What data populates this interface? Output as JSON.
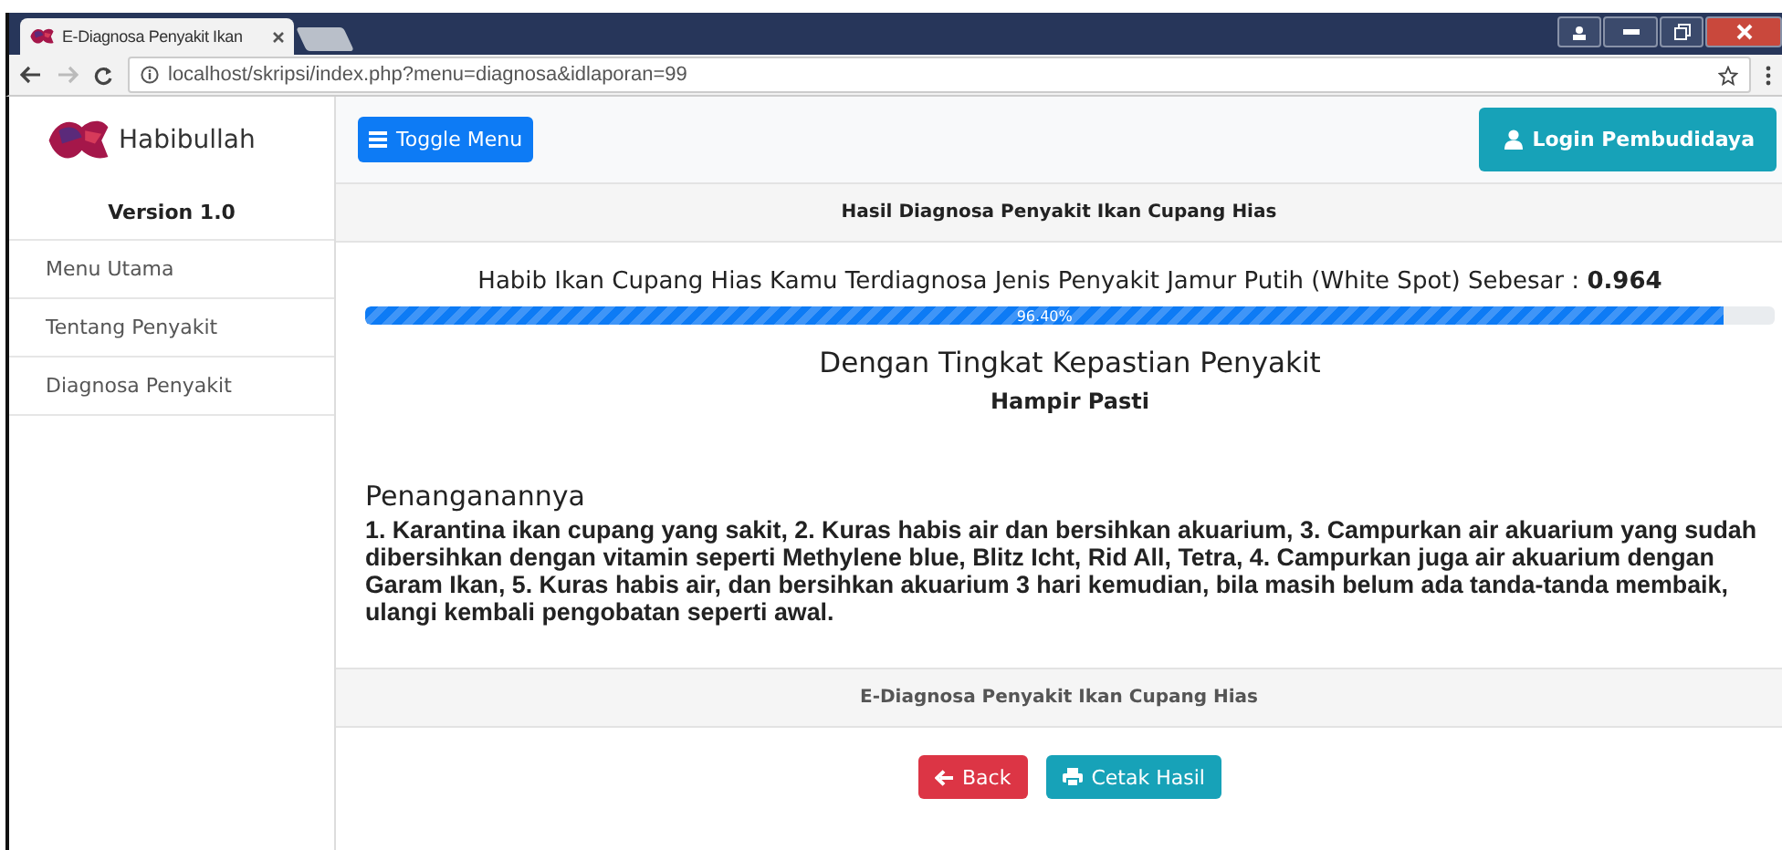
{
  "browser": {
    "tab_title": "E-Diagnosa Penyakit Ikan",
    "url": "localhost/skripsi/index.php?menu=diagnosa&idlaporan=99"
  },
  "sidebar": {
    "brand": "Habibullah",
    "version": "Version 1.0",
    "items": [
      "Menu Utama",
      "Tentang Penyakit",
      "Diagnosa Penyakit"
    ]
  },
  "navbar": {
    "toggle_button": "Toggle Menu",
    "login_button": "Login Pembudidaya"
  },
  "card": {
    "header": "Hasil Diagnosa Penyakit Ikan Cupang Hias",
    "result": "Habib Ikan Cupang Hias Kamu Terdiagnosa Jenis Penyakit Jamur Putih (White Spot) Sebesar : **0.964**",
    "progress": {
      "level": 0.964,
      "label": "96.40%"
    },
    "certainty_title": "Dengan Tingkat Kepastian Penyakit",
    "certainty_value": "Hampir Pasti",
    "treatment_title": "Penanganannya",
    "treatment_text": "1. Karantina ikan cupang yang sakit, 2. Kuras habis air dan bersihkan akuarium, 3. Campurkan air akuarium yang sudah dibersihkan dengan vitamin seperti Methylene blue, Blitz Icht, Rid All, Tetra, 4. Campurkan juga air akuarium dengan Garam Ikan, 5. Kuras habis air, dan bersihkan akuarium 3 hari kemudian, bila masih belum ada tanda-tanda membaik, ulangi kembali pengobatan seperti awal.",
    "footer": "E-Diagnosa Penyakit Ikan Cupang Hias"
  },
  "actions": [
    {
      "kind": "back",
      "label": "Back"
    },
    {
      "kind": "print",
      "label": "Cetak Hasil"
    }
  ]
}
